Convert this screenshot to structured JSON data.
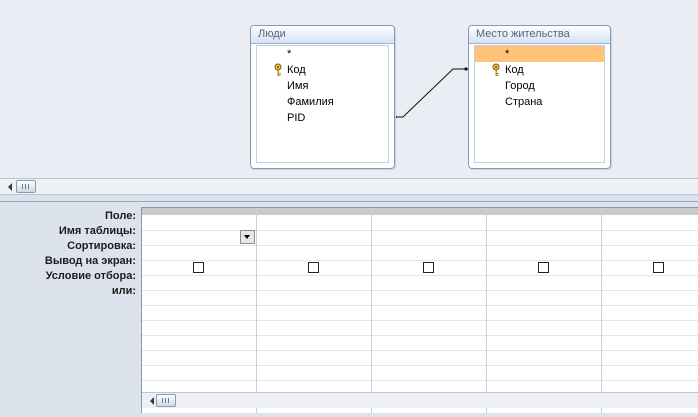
{
  "tables": [
    {
      "title": "Люди",
      "fields": [
        {
          "label": "*",
          "key": false,
          "selected": false
        },
        {
          "label": "Код",
          "key": true,
          "selected": false
        },
        {
          "label": "Имя",
          "key": false,
          "selected": false
        },
        {
          "label": "Фамилия",
          "key": false,
          "selected": false
        },
        {
          "label": "PID",
          "key": false,
          "selected": false
        }
      ]
    },
    {
      "title": "Место жительства",
      "fields": [
        {
          "label": "*",
          "key": false,
          "selected": true
        },
        {
          "label": "Код",
          "key": true,
          "selected": false
        },
        {
          "label": "Город",
          "key": false,
          "selected": false
        },
        {
          "label": "Страна",
          "key": false,
          "selected": false
        }
      ]
    }
  ],
  "grid": {
    "row_labels": [
      "Поле:",
      "Имя таблицы:",
      "Сортировка:",
      "Вывод на экран:",
      "Условие отбора:",
      "или:"
    ],
    "column_count": 5,
    "show_checked": [
      false,
      false,
      false,
      false,
      false
    ]
  },
  "colors": {
    "selected_field": "#ffc37a",
    "diagram_background": "#eaedf3"
  },
  "icons": [
    "primary-key-icon",
    "dropdown-arrow-icon",
    "scroll-left-arrow-icon"
  ]
}
